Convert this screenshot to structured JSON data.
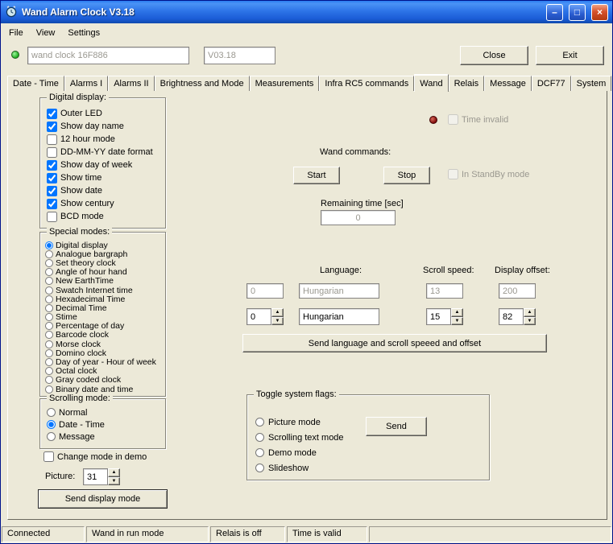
{
  "window": {
    "title": "Wand Alarm Clock V3.18",
    "icons": {
      "minimize": "–",
      "maximize": "□",
      "close": "×"
    }
  },
  "menu": {
    "items": [
      "File",
      "View",
      "Settings"
    ]
  },
  "connection": {
    "device_field": "wand clock 16F886",
    "version_field": "V03.18",
    "close_button": "Close",
    "exit_button": "Exit"
  },
  "tabs": {
    "active": "Wand",
    "items": [
      "Date - Time",
      "Alarms I",
      "Alarms II",
      "Brightness and Mode",
      "Measurements",
      "Infra RC5 commands",
      "Wand",
      "Relais",
      "Message",
      "DCF77",
      "System"
    ]
  },
  "digital_display": {
    "title": "Digital display:",
    "items": [
      {
        "label": "Outer LED",
        "checked": true
      },
      {
        "label": "Show day name",
        "checked": true
      },
      {
        "label": "12 hour mode",
        "checked": false
      },
      {
        "label": "DD-MM-YY date format",
        "checked": false
      },
      {
        "label": "Show day of week",
        "checked": true
      },
      {
        "label": "Show time",
        "checked": true
      },
      {
        "label": "Show date",
        "checked": true
      },
      {
        "label": "Show century",
        "checked": true
      },
      {
        "label": "BCD mode",
        "checked": false
      }
    ]
  },
  "special_modes": {
    "title": "Special modes:",
    "items": [
      {
        "label": "Digital display",
        "selected": true
      },
      {
        "label": "Analogue bargraph",
        "selected": false
      },
      {
        "label": "Set theory clock",
        "selected": false
      },
      {
        "label": "Angle of hour hand",
        "selected": false
      },
      {
        "label": "New EarthTime",
        "selected": false
      },
      {
        "label": "Swatch Internet time",
        "selected": false
      },
      {
        "label": "Hexadecimal Time",
        "selected": false
      },
      {
        "label": "Decimal Time",
        "selected": false
      },
      {
        "label": "Stime",
        "selected": false
      },
      {
        "label": "Percentage of day",
        "selected": false
      },
      {
        "label": "Barcode clock",
        "selected": false
      },
      {
        "label": "Morse clock",
        "selected": false
      },
      {
        "label": "Domino clock",
        "selected": false
      },
      {
        "label": "Day of year - Hour of week",
        "selected": false
      },
      {
        "label": "Octal clock",
        "selected": false
      },
      {
        "label": "Gray coded clock",
        "selected": false
      },
      {
        "label": "Binary date and time",
        "selected": false
      }
    ]
  },
  "scrolling_mode": {
    "title": "Scrolling mode:",
    "items": [
      {
        "label": "Normal",
        "selected": false
      },
      {
        "label": "Date - Time",
        "selected": true
      },
      {
        "label": "Message",
        "selected": false
      }
    ]
  },
  "demo_checkbox": {
    "label": "Change mode in demo",
    "checked": false
  },
  "picture": {
    "label": "Picture:",
    "value": "31"
  },
  "send_display_button": "Send display mode",
  "wand": {
    "time_invalid": {
      "label": "Time invalid",
      "checked": false
    },
    "commands_label": "Wand commands:",
    "start_button": "Start",
    "stop_button": "Stop",
    "standby": {
      "label": "In StandBy mode",
      "checked": false
    },
    "remaining_label": "Remaining time [sec]",
    "remaining_value": "0",
    "language_label": "Language:",
    "scroll_speed_label": "Scroll speed:",
    "display_offset_label": "Display offset:",
    "row1": {
      "num": "0",
      "language": "Hungarian",
      "scroll_speed": "13",
      "offset": "200"
    },
    "row2": {
      "num": "0",
      "language": "Hungarian",
      "scroll_speed": "15",
      "offset": "82"
    },
    "send_language_button": "Send language and scroll speeed and offset"
  },
  "system_flags": {
    "title": "Toggle system flags:",
    "items": [
      {
        "label": "Picture mode",
        "selected": false
      },
      {
        "label": "Scrolling text mode",
        "selected": false
      },
      {
        "label": "Demo mode",
        "selected": false
      },
      {
        "label": "Slideshow",
        "selected": false
      }
    ],
    "send_button": "Send"
  },
  "status_bar": {
    "panels": [
      "Connected",
      "Wand in run mode",
      "Relais is off",
      "Time is valid",
      ""
    ]
  },
  "icons": {
    "spin_up": "▲",
    "spin_down": "▼"
  },
  "colors": {
    "window_bg": "#ECE9D8",
    "titlebar": "#2A66E0",
    "led_green": "#2DB52D",
    "led_red": "#7D0A0A"
  }
}
